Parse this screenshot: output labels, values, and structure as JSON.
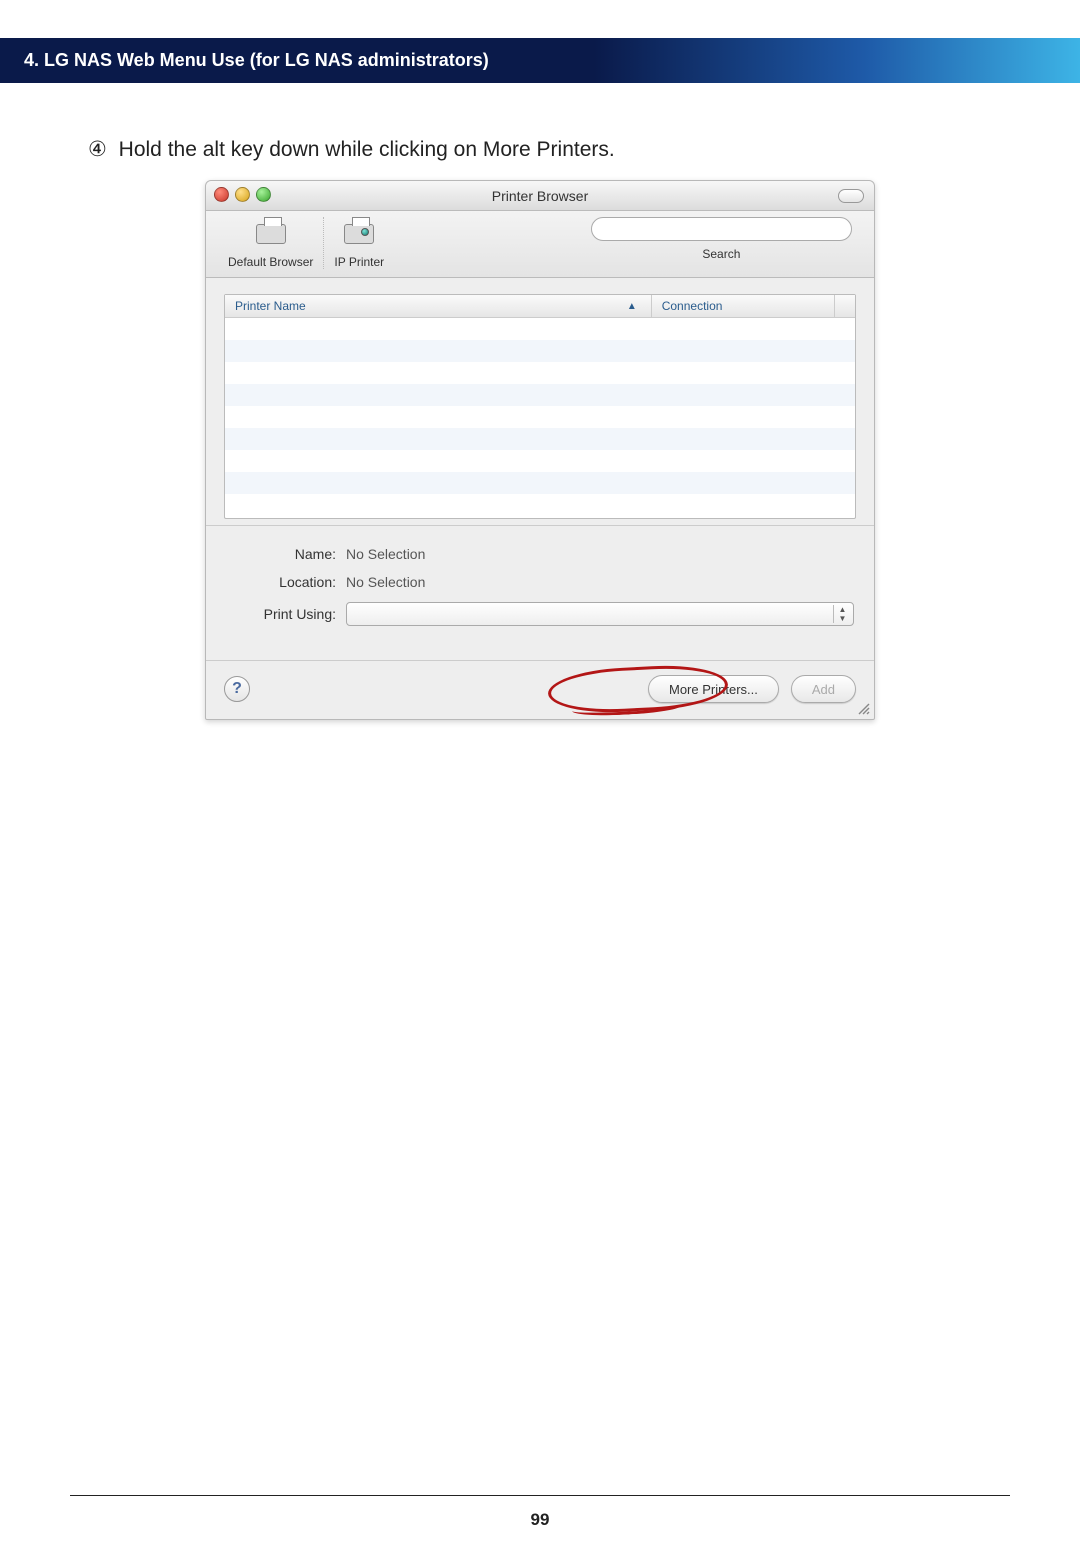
{
  "header": {
    "title": "4. LG NAS Web Menu Use (for LG NAS administrators)"
  },
  "instruction": {
    "number": "④",
    "text": "Hold the alt key down while clicking on More Printers."
  },
  "window": {
    "title": "Printer Browser",
    "toolbar": {
      "default_browser": "Default Browser",
      "ip_printer": "IP Printer",
      "search_label": "Search",
      "search_placeholder": ""
    },
    "list": {
      "col_name": "Printer Name",
      "col_connection": "Connection"
    },
    "form": {
      "name_label": "Name:",
      "name_value": "No Selection",
      "location_label": "Location:",
      "location_value": "No Selection",
      "print_using_label": "Print Using:"
    },
    "buttons": {
      "help": "?",
      "more_printers": "More Printers...",
      "add": "Add"
    }
  },
  "page_number": "99"
}
